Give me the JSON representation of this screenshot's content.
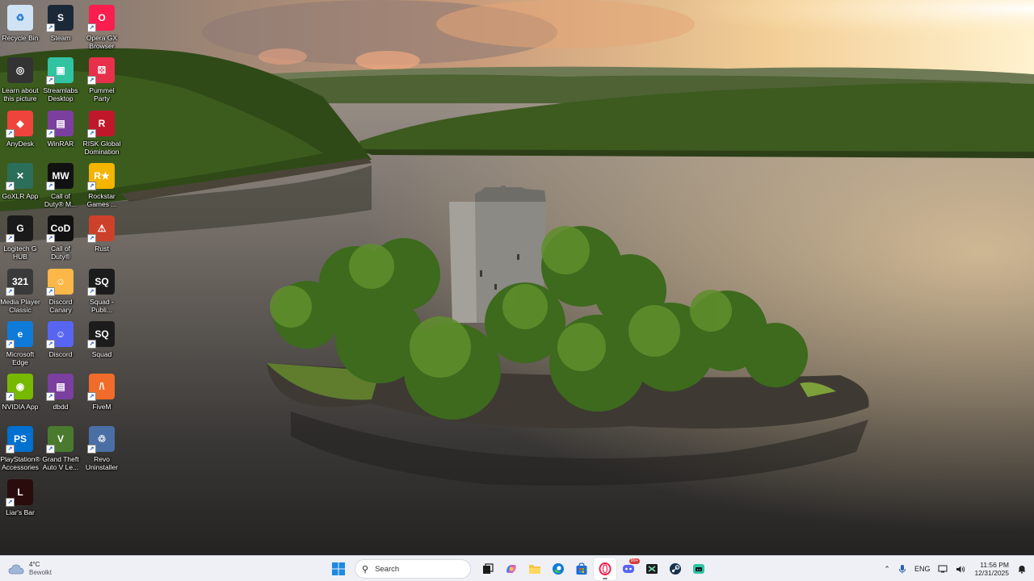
{
  "desktop": {
    "icons": [
      {
        "label": "Recycle Bin",
        "icon": "recycle-bin-icon",
        "color": "#cfe3f5"
      },
      {
        "label": "Steam",
        "icon": "steam-icon",
        "color": "#1b2838"
      },
      {
        "label": "Opera GX Browser",
        "icon": "opera-gx-icon",
        "color": "#fa1e4e"
      },
      {
        "label": "Learn about this picture",
        "icon": "learn-about-picture-icon",
        "color": "#333333"
      },
      {
        "label": "Streamlabs Desktop",
        "icon": "streamlabs-icon",
        "color": "#31c3a2"
      },
      {
        "label": "Pummel Party",
        "icon": "pummel-party-icon",
        "color": "#e8304a"
      },
      {
        "label": "AnyDesk",
        "icon": "anydesk-icon",
        "color": "#ef443b"
      },
      {
        "label": "WinRAR",
        "icon": "winrar-icon",
        "color": "#7b3fa0"
      },
      {
        "label": "RISK Global Domination",
        "icon": "risk-icon",
        "color": "#c0182b"
      },
      {
        "label": "GoXLR App",
        "icon": "goxlr-icon",
        "color": "#2b6e5a"
      },
      {
        "label": "Call of Duty® M...",
        "icon": "cod-mw-icon",
        "color": "#111111"
      },
      {
        "label": "Rockstar Games ...",
        "icon": "rockstar-icon",
        "color": "#f4b400"
      },
      {
        "label": "Logitech G HUB",
        "icon": "logitech-ghub-icon",
        "color": "#1a1a1a"
      },
      {
        "label": "Call of Duty®",
        "icon": "cod-icon",
        "color": "#111111"
      },
      {
        "label": "Rust",
        "icon": "rust-icon",
        "color": "#cd412b"
      },
      {
        "label": "Media Player Classic",
        "icon": "media-player-classic-icon",
        "color": "#3a3a3a"
      },
      {
        "label": "Discord Canary",
        "icon": "discord-canary-icon",
        "color": "#fbb848"
      },
      {
        "label": "Squad - Publi...",
        "icon": "squad-public-icon",
        "color": "#1c1c1c"
      },
      {
        "label": "Microsoft Edge",
        "icon": "edge-icon",
        "color": "#0f7bd8"
      },
      {
        "label": "Discord",
        "icon": "discord-icon",
        "color": "#5865f2"
      },
      {
        "label": "Squad",
        "icon": "squad-icon",
        "color": "#1c1c1c"
      },
      {
        "label": "NVIDIA App",
        "icon": "nvidia-icon",
        "color": "#76b900"
      },
      {
        "label": "dbdd",
        "icon": "winrar-archive-icon",
        "color": "#7b3fa0"
      },
      {
        "label": "FiveM",
        "icon": "fivem-icon",
        "color": "#f16c2a"
      },
      {
        "label": "PlayStation® Accessories",
        "icon": "playstation-icon",
        "color": "#0070d1"
      },
      {
        "label": "Grand Theft Auto V Le...",
        "icon": "gta-v-icon",
        "color": "#4a7a2e"
      },
      {
        "label": "Revo Uninstaller",
        "icon": "revo-uninstaller-icon",
        "color": "#4a6fa5"
      },
      {
        "label": "Liar's Bar",
        "icon": "liars-bar-icon",
        "color": "#2a0c0c"
      }
    ]
  },
  "taskbar": {
    "weather": {
      "temp": "4°C",
      "condition": "Bewolkt"
    },
    "search_placeholder": "Search",
    "apps": [
      {
        "name": "start-button",
        "icon": "windows-start-icon",
        "active": false
      },
      {
        "name": "task-view-button",
        "icon": "task-view-icon",
        "active": false
      },
      {
        "name": "copilot-button",
        "icon": "copilot-icon",
        "active": false
      },
      {
        "name": "file-explorer-button",
        "icon": "folder-icon",
        "active": false
      },
      {
        "name": "edge-button",
        "icon": "edge-icon",
        "active": false
      },
      {
        "name": "store-button",
        "icon": "store-icon",
        "active": false
      },
      {
        "name": "opera-gx-button",
        "icon": "opera-gx-icon",
        "active": true
      },
      {
        "name": "discord-button",
        "icon": "discord-icon",
        "active": false,
        "badge": "99+"
      },
      {
        "name": "goxlr-button",
        "icon": "goxlr-icon",
        "active": false
      },
      {
        "name": "steam-button",
        "icon": "steam-icon",
        "active": false
      },
      {
        "name": "streamlabs-button",
        "icon": "streamlabs-icon",
        "active": false
      }
    ],
    "tray": {
      "language": "ENG",
      "time": "11:56 PM",
      "date": "12/31/2025"
    }
  }
}
